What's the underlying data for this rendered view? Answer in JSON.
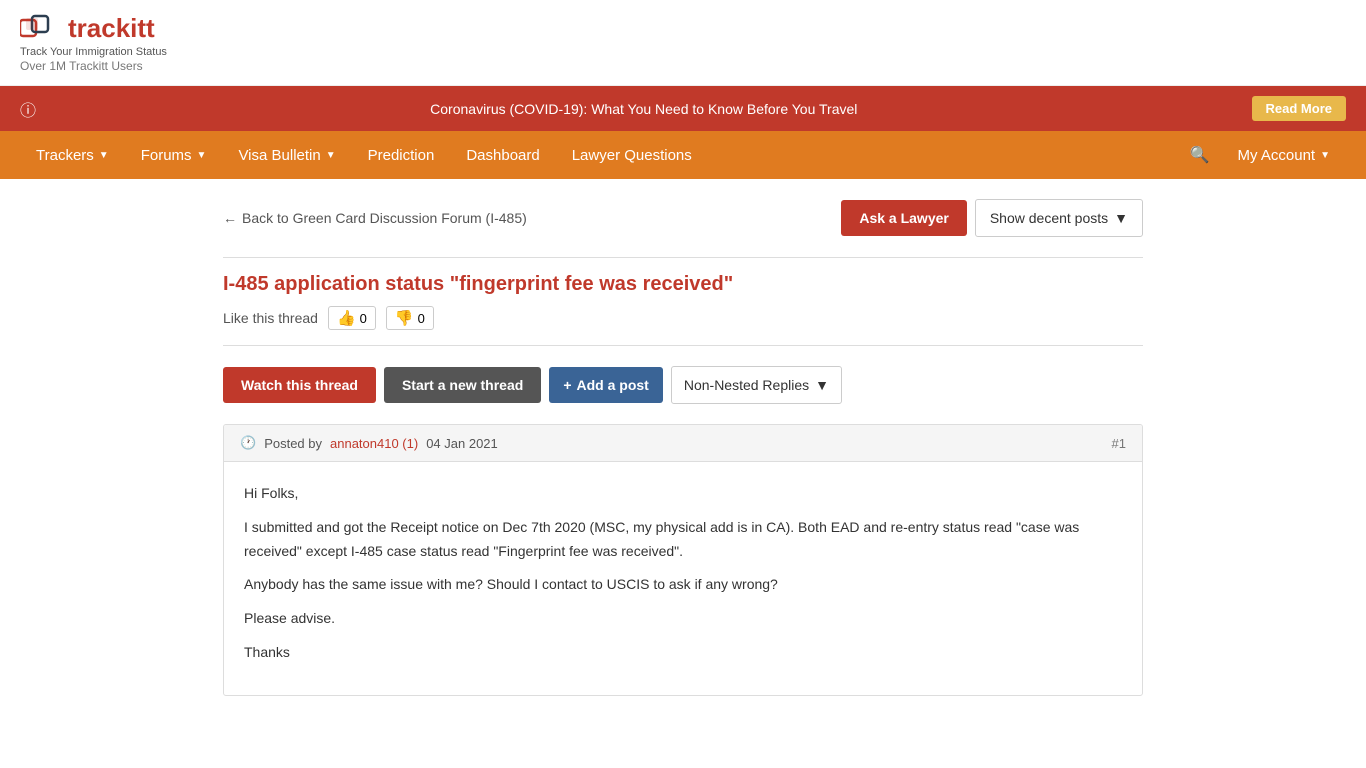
{
  "site": {
    "logo_text": "trackitt",
    "logo_sub": "Track Your Immigration Status",
    "logo_users": "Over 1M Trackitt Users"
  },
  "alert": {
    "text": "Coronavirus (COVID-19): What You Need to Know Before You Travel",
    "read_more": "Read More"
  },
  "nav": {
    "items": [
      {
        "label": "Trackers",
        "dropdown": true
      },
      {
        "label": "Forums",
        "dropdown": true
      },
      {
        "label": "Visa Bulletin",
        "dropdown": true
      },
      {
        "label": "Prediction",
        "dropdown": false
      },
      {
        "label": "Dashboard",
        "dropdown": false
      },
      {
        "label": "Lawyer Questions",
        "dropdown": false
      }
    ],
    "account_label": "My Account",
    "search_icon": "🔍"
  },
  "breadcrumb": {
    "back_label": "Back to Green Card Discussion Forum (I-485)"
  },
  "actions": {
    "ask_lawyer": "Ask a Lawyer",
    "show_decent": "Show decent posts",
    "watch_thread": "Watch this thread",
    "start_new_thread": "Start a new thread",
    "add_post": "+ Add a post",
    "replies_type": "Non-Nested Replies"
  },
  "thread": {
    "title": "I-485 application status \"fingerprint fee was received\"",
    "like_label": "Like this thread",
    "like_count": "0",
    "dislike_count": "0"
  },
  "post": {
    "clock_icon": "🕐",
    "posted_by": "Posted by",
    "author": "annaton410 (1)",
    "date": "04 Jan 2021",
    "number": "#1",
    "body_lines": [
      "Hi Folks,",
      "I submitted and got the Receipt notice on Dec 7th 2020 (MSC, my physical add is in CA). Both EAD and re-entry status read \"case was received\" except I-485 case status read \"Fingerprint fee was received\".",
      "Anybody has the same issue with me? Should I contact to USCIS to ask if any wrong?",
      "Please advise.",
      "Thanks"
    ]
  }
}
